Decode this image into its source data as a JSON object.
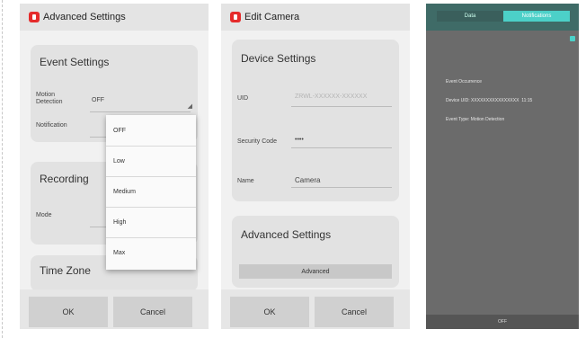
{
  "screen1": {
    "title": "Advanced Settings",
    "event_settings": {
      "title": "Event Settings",
      "motion_detection_label": "Motion\nDetection",
      "motion_detection_value": "OFF",
      "notification_label": "Notification"
    },
    "recording": {
      "title": "Recording",
      "mode_label": "Mode"
    },
    "time_zone_title": "Time Zone",
    "dropdown_options": [
      "OFF",
      "Low",
      "Medium",
      "High",
      "Max"
    ],
    "ok_label": "OK",
    "cancel_label": "Cancel"
  },
  "screen2": {
    "title": "Edit Camera",
    "device_settings": {
      "title": "Device Settings",
      "uid_label": "UID",
      "uid_value": "ZRWL-XXXXXX-XXXXXX",
      "security_code_label": "Security Code",
      "security_code_value": "••••",
      "name_label": "Name",
      "name_value": "Camera"
    },
    "advanced_settings": {
      "title": "Advanced Settings",
      "button_label": "Advanced"
    },
    "ok_label": "OK",
    "cancel_label": "Cancel"
  },
  "screen3": {
    "tabs": [
      "Data",
      "Notifications"
    ],
    "log_lines": [
      "Event Occurrence",
      "Device UID: XXXXXXXXXXXXXXXX  11:15",
      "Event Type: Motion Detection"
    ],
    "footer": "OFF"
  },
  "colors": {
    "app_icon": "#e52b2b",
    "dark_header": "#3f6b67",
    "tab_active": "#4cd0c8"
  }
}
